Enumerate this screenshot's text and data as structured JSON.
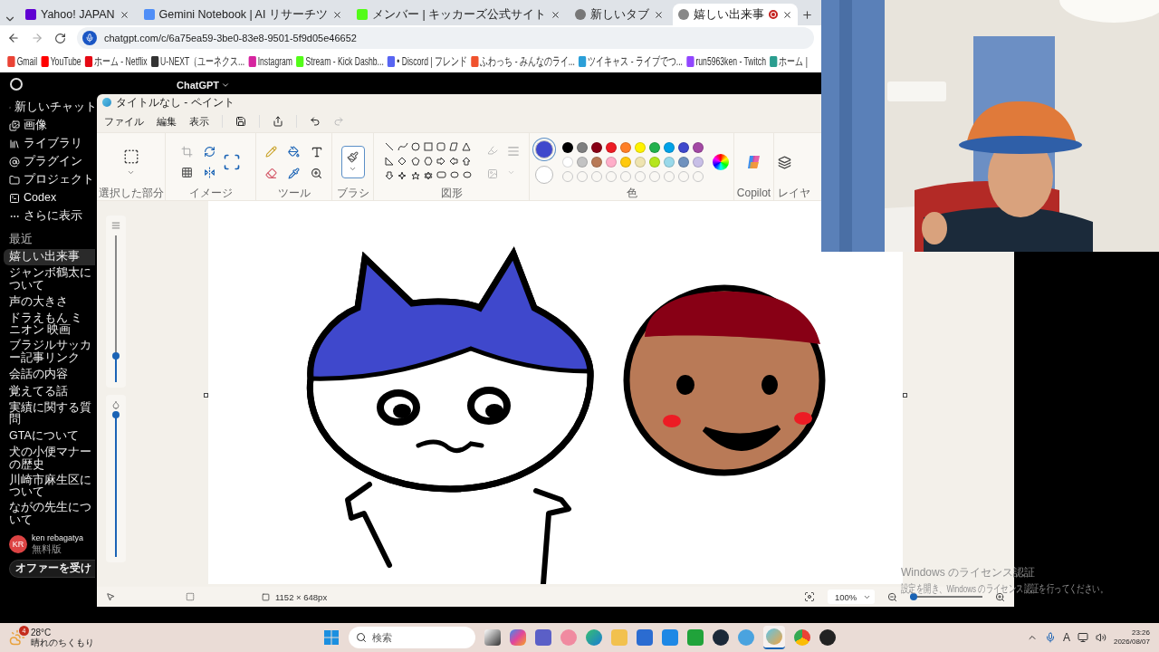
{
  "browser": {
    "tabs": [
      {
        "label": "Yahoo! JAPAN",
        "selected": false
      },
      {
        "label": "Gemini Notebook | AI リサーチツ",
        "selected": false
      },
      {
        "label": "メンバー | キッカーズ公式サイト",
        "selected": false
      },
      {
        "label": "新しいタブ",
        "selected": false
      },
      {
        "label": "嬉しい出来事",
        "selected": true
      }
    ],
    "address": "chatgpt.com/c/6a75ea59-3be0-83e8-9501-5f9d05e46652",
    "bookmarks": [
      "Gmail",
      "YouTube",
      "ホーム - Netflix",
      "U-NEXT（ユーネクス...",
      "Instagram",
      "Stream - Kick Dashb...",
      "• Discord | フレンド",
      "ふわっち - みんなのライ...",
      "ツイキャス - ライブでつ...",
      "run5963ken - Twitch",
      "ホーム |"
    ]
  },
  "chat": {
    "title": "ChatGPT",
    "nav": [
      "新しいチャット",
      "画像",
      "ライブラリ",
      "プラグイン",
      "プロジェクト",
      "Codex",
      "さらに表示"
    ],
    "recent_label": "最近",
    "chats": [
      {
        "label": "嬉しい出来事",
        "selected": true
      },
      {
        "label": "ジャンボ鶴太について",
        "selected": false
      },
      {
        "label": "声の大きさ",
        "selected": false
      },
      {
        "label": "ドラえもん ミニオン 映画",
        "selected": false
      },
      {
        "label": "ブラジルサッカー記事リンク",
        "selected": false
      },
      {
        "label": "会話の内容",
        "selected": false
      },
      {
        "label": "覚えてる話",
        "selected": false
      },
      {
        "label": "実績に関する質問",
        "selected": false
      },
      {
        "label": "GTAについて",
        "selected": false
      },
      {
        "label": "犬の小便マナーの歴史",
        "selected": false
      },
      {
        "label": "川崎市麻生区について",
        "selected": false
      },
      {
        "label": "ながの先生について",
        "selected": false
      }
    ],
    "user": {
      "initials": "KR",
      "name": "ken rebagatya",
      "plan": "無料版"
    },
    "offer_button": "オファーを受け"
  },
  "paint": {
    "title": "タイトルなし - ペイント",
    "menu": [
      "ファイル",
      "編集",
      "表示"
    ],
    "groups": [
      "選択した部分",
      "イメージ",
      "ツール",
      "ブラシ",
      "図形",
      "色",
      "Copilot",
      "レイヤ"
    ],
    "brush_selected": true,
    "primary": {
      "color": "#3f48cc"
    },
    "secondary": {
      "color": "#ffffff"
    },
    "palette": [
      {
        "color": "#000000"
      },
      {
        "color": "#7f7f7f"
      },
      {
        "color": "#880015"
      },
      {
        "color": "#ed1c24"
      },
      {
        "color": "#ff7f27"
      },
      {
        "color": "#fff200"
      },
      {
        "color": "#22b14c"
      },
      {
        "color": "#00a2e8"
      },
      {
        "color": "#3f48cc"
      },
      {
        "color": "#a349a4"
      },
      {
        "color": "#ffffff"
      },
      {
        "color": "#c3c3c3"
      },
      {
        "color": "#b97a57"
      },
      {
        "color": "#ffaec9"
      },
      {
        "color": "#ffc90e"
      },
      {
        "color": "#efe4b0"
      },
      {
        "color": "#b5e61d"
      },
      {
        "color": "#99d9ea"
      },
      {
        "color": "#7092be"
      },
      {
        "color": "#c8bfe7"
      }
    ],
    "size_slider": {
      "level": 0.18
    },
    "opacity_slider": {
      "level": 1
    },
    "canvas_size": "1152 × 648px",
    "zoom": "100%",
    "zoom_slider": {
      "level": 0.05
    }
  },
  "taskbar": {
    "weather": {
      "badge": "4",
      "temp": "28°C",
      "text": "晴れのちくもり"
    },
    "search_placeholder": "検索",
    "ime": "A",
    "time": "23:26",
    "date": "2026/08/07"
  },
  "watermark": {
    "title": "Windows のライセンス認証",
    "text": "設定を開き、Windows のライセンス認証を行ってください。"
  }
}
